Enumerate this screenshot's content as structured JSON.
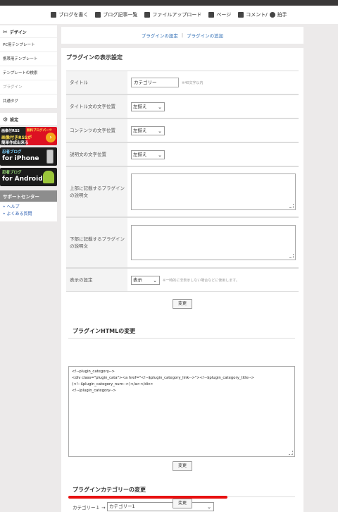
{
  "nav": {
    "items": [
      {
        "label": "ブログを書く",
        "icon": "pencil-icon"
      },
      {
        "label": "ブログ記事一覧",
        "icon": "document-list-icon"
      },
      {
        "label": "ファイルアップロード",
        "icon": "upload-icon"
      },
      {
        "label": "ページ",
        "icon": "sitemap-icon"
      },
      {
        "label": "コメント/",
        "icon": "comment-icon"
      },
      {
        "label": "拍手",
        "icon": "clap-icon"
      }
    ]
  },
  "sidebar": {
    "design_heading": "デザイン",
    "design_links": [
      "PC用テンプレート",
      "携帯用テンプレート",
      "テンプレートの検索",
      "プラグイン",
      "共通タグ"
    ],
    "settings_heading": "設定",
    "banners": {
      "rss": {
        "line1": "画像付RSS",
        "line1b": "無料ブログパーツ",
        "line2": "画像付きRSSが",
        "line3": "簡単作成出来る"
      },
      "iphone": {
        "line1": "忍者ブログ",
        "line2": "for iPhone"
      },
      "android": {
        "line1": "忍者ブログ",
        "line2": "for Android"
      }
    },
    "support": {
      "heading": "サポートセンター",
      "links": [
        "ヘルプ",
        "よくある質問"
      ]
    }
  },
  "main": {
    "top_links": {
      "settings": "プラグインの設定",
      "separator": "|",
      "add": "プラグインの追加"
    },
    "display_section_title": "プラグインの表示設定",
    "rows": {
      "title_label": "タイトル",
      "title_value": "カテゴリー",
      "title_note": "※40文字以内",
      "title_align_label": "タイトル文の文字位置",
      "title_align_value": "左揃え",
      "content_align_label": "コンテンツの文字位置",
      "content_align_value": "左揃え",
      "desc_align_label": "説明文の文字位置",
      "desc_align_value": "左揃え",
      "upper_desc_label": "上部に記載するプラグインの説明文",
      "lower_desc_label": "下部に記載するプラグインの説明文",
      "display_label": "表示の設定",
      "display_value": "表示",
      "display_note": "※一時的に非表示しない場合などに使用します。"
    },
    "change_button": "変更",
    "html_section_title": "プラグインHTMLの変更",
    "html_code": "<!--plugin_category-->\n<div class=\"plugin_cata\"><a href=\"<!--$plugin_category_link-->\"><!--$plugin_category_title-->\n(<!--$plugin_category_num-->)</a></div>\n<!--/plugin_category-->",
    "category_section_title": "プラグインカテゴリーの変更",
    "category_label": "カテゴリー１ →",
    "category_value": "カテゴリー1"
  },
  "colors": {
    "accent_link": "#2a6ab3",
    "highlight": "#e81010",
    "banner_red": "#dd1122"
  }
}
